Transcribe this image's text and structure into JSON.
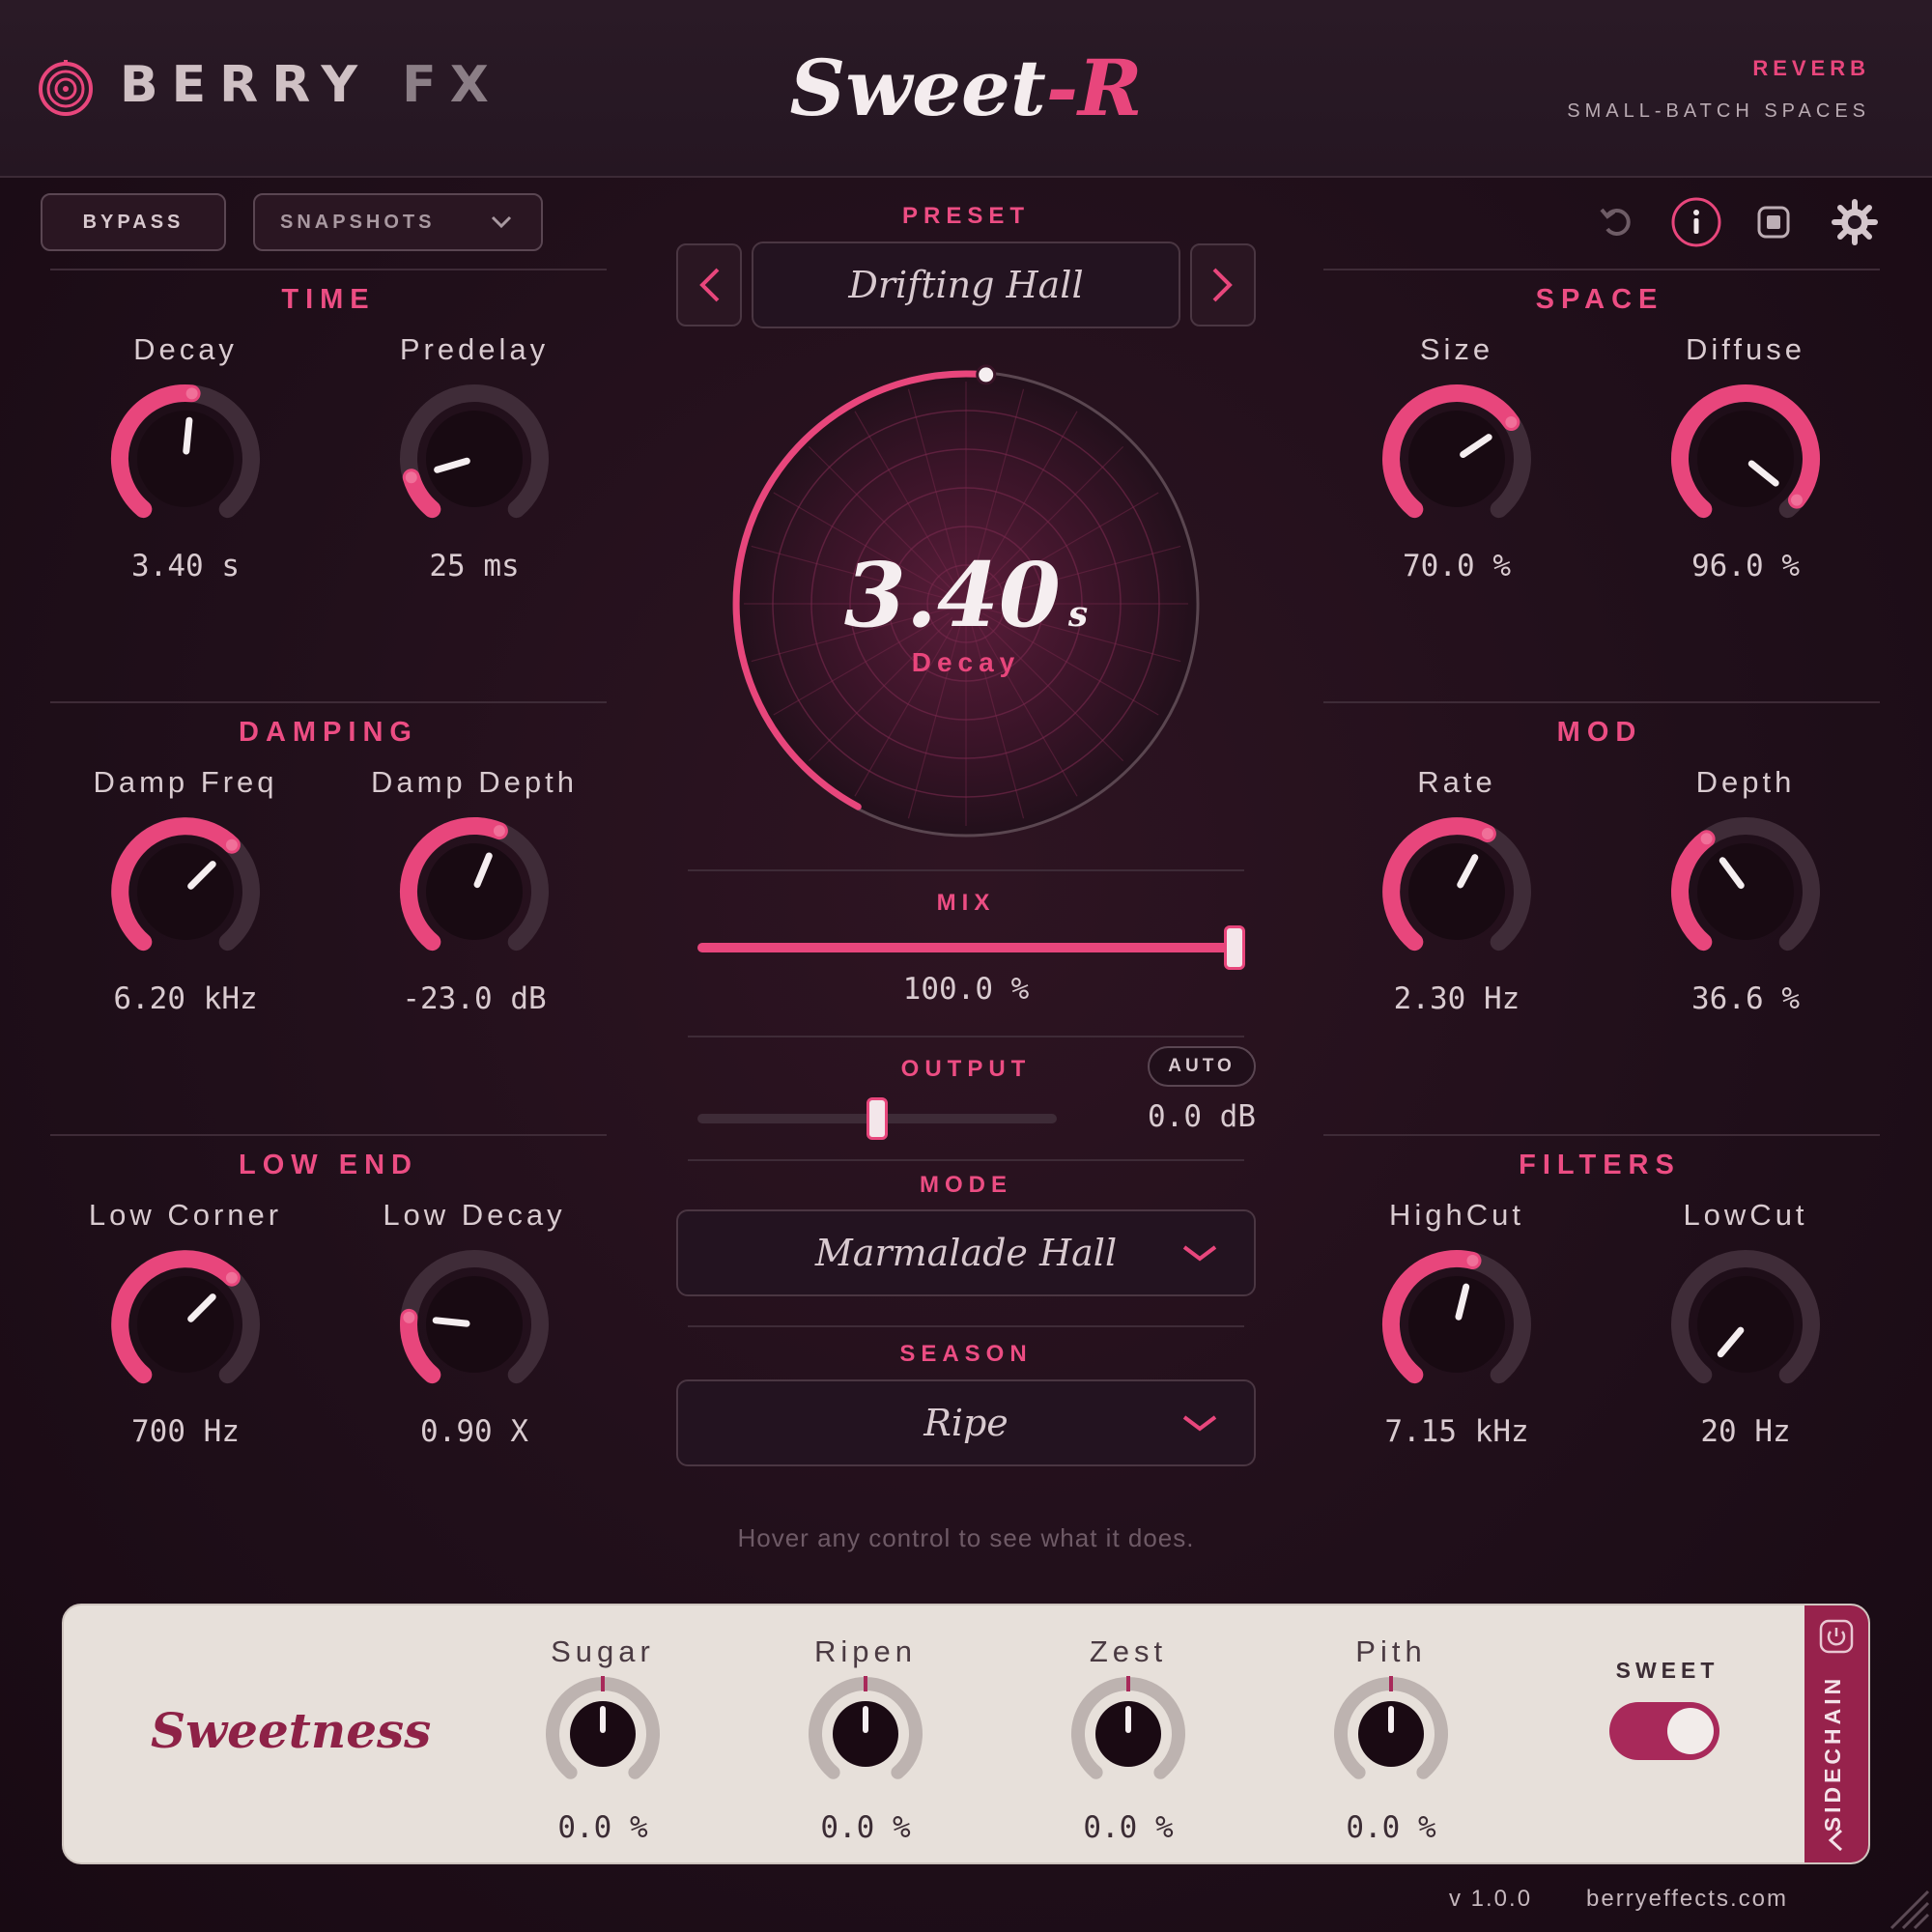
{
  "header": {
    "brand_name": "BERRY",
    "brand_suffix": "FX",
    "title_main": "Sweet",
    "title_accent": "-R",
    "category": "REVERB",
    "tagline": "SMALL-BATCH SPACES"
  },
  "toolbar": {
    "bypass_label": "BYPASS",
    "snapshots_label": "SNAPSHOTS",
    "icons": [
      "undo-icon",
      "info-icon",
      "stop-icon",
      "gear-icon"
    ]
  },
  "preset": {
    "label": "PRESET",
    "name": "Drifting Hall"
  },
  "sections": {
    "time": {
      "title": "TIME",
      "knobs": [
        {
          "label": "Decay",
          "value": "3.40 s",
          "level": 0.52
        },
        {
          "label": "Predelay",
          "value": "25 ms",
          "level": 0.12
        }
      ]
    },
    "damping": {
      "title": "DAMPING",
      "knobs": [
        {
          "label": "Damp Freq",
          "value": "6.20 kHz",
          "level": 0.66
        },
        {
          "label": "Damp Depth",
          "value": "-23.0 dB",
          "level": 0.58
        }
      ]
    },
    "low_end": {
      "title": "LOW END",
      "knobs": [
        {
          "label": "Low Corner",
          "value": "700 Hz",
          "level": 0.66
        },
        {
          "label": "Low Decay",
          "value": "0.90 X",
          "level": 0.2
        }
      ]
    },
    "space": {
      "title": "SPACE",
      "knobs": [
        {
          "label": "Size",
          "value": "70.0 %",
          "level": 0.7
        },
        {
          "label": "Diffuse",
          "value": "96.0 %",
          "level": 0.96
        }
      ]
    },
    "mod": {
      "title": "MOD",
      "knobs": [
        {
          "label": "Rate",
          "value": "2.30 Hz",
          "level": 0.6
        },
        {
          "label": "Depth",
          "value": "36.6 %",
          "level": 0.37
        }
      ]
    },
    "filters": {
      "title": "FILTERS",
      "knobs": [
        {
          "label": "HighCut",
          "value": "7.15 kHz",
          "level": 0.55
        },
        {
          "label": "LowCut",
          "value": "20 Hz",
          "level": 0.0
        }
      ]
    }
  },
  "center_dial": {
    "value": "3.40",
    "unit": "s",
    "label": "Decay",
    "level": 0.62
  },
  "mix": {
    "label": "MIX",
    "value": "100.0 %",
    "level": 1.0
  },
  "output": {
    "label": "OUTPUT",
    "auto_label": "AUTO",
    "value": "0.0 dB",
    "level": 0.5
  },
  "mode": {
    "label": "MODE",
    "selected": "Marmalade Hall"
  },
  "season": {
    "label": "SEASON",
    "selected": "Ripe"
  },
  "hint": "Hover any control to see what it does.",
  "sweetness": {
    "title": "Sweetness",
    "knobs": [
      {
        "label": "Sugar",
        "value": "0.0 %",
        "level": 0.0
      },
      {
        "label": "Ripen",
        "value": "0.0 %",
        "level": 0.0
      },
      {
        "label": "Zest",
        "value": "0.0 %",
        "level": 0.0
      },
      {
        "label": "Pith",
        "value": "0.0 %",
        "level": 0.0
      }
    ],
    "toggle_label": "SWEET",
    "toggle_on": true,
    "sidechain_label": "SIDECHAIN"
  },
  "footer": {
    "version": "v 1.0.0",
    "website": "berryeffects.com"
  },
  "colors": {
    "accent": "#e8467c",
    "background": "#200f1a",
    "panel_light": "#e7e0da",
    "sweet_accent": "#97224c"
  }
}
